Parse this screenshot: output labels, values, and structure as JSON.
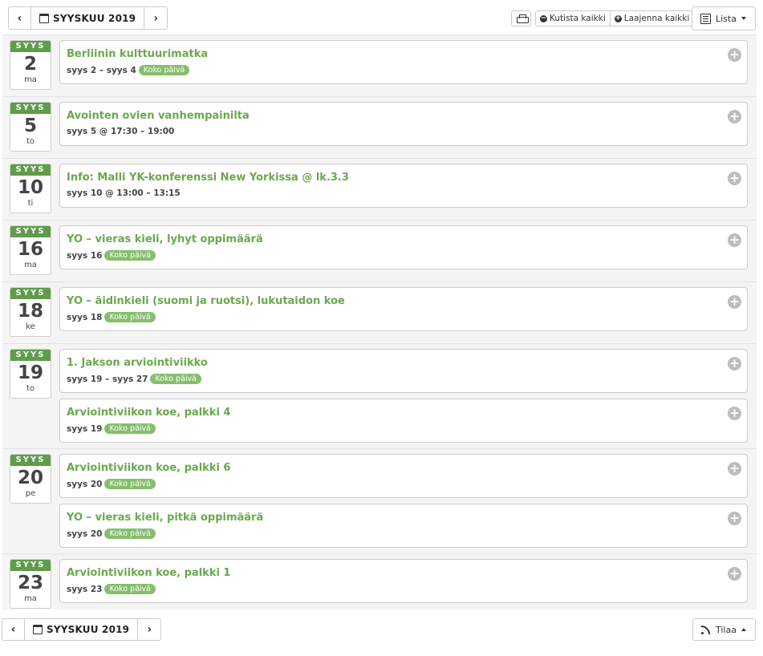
{
  "toolbar": {
    "month_label": "SYYSKUU 2019",
    "prev_label": "‹",
    "next_label": "›",
    "collapse_label": "Kutista kaikki",
    "expand_label": "Laajenna kaikki",
    "view_label": "Lista"
  },
  "footer": {
    "month_label": "SYYSKUU 2019",
    "subscribe_label": "Tilaa"
  },
  "colors": {
    "accent": "#5f9c4b",
    "title": "#6aa84f",
    "pill": "#86be6c"
  },
  "days": [
    {
      "mon": "SYYS",
      "num": "2",
      "dow": "ma",
      "events": [
        {
          "title": "Berliinin kulttuurimatka",
          "time": "syys 2 – syys 4",
          "allday": "Koko päivä"
        }
      ]
    },
    {
      "mon": "SYYS",
      "num": "5",
      "dow": "to",
      "events": [
        {
          "title": "Avointen ovien vanhempainilta",
          "time": "syys 5 @ 17:30 – 19:00",
          "allday": ""
        }
      ]
    },
    {
      "mon": "SYYS",
      "num": "10",
      "dow": "ti",
      "events": [
        {
          "title": "Info: Malli YK-konferenssi New Yorkissa @ lk.3.3",
          "time": "syys 10 @ 13:00 – 13:15",
          "allday": ""
        }
      ]
    },
    {
      "mon": "SYYS",
      "num": "16",
      "dow": "ma",
      "events": [
        {
          "title": "YO – vieras kieli, lyhyt oppimäärä",
          "time": "syys 16",
          "allday": "Koko päivä"
        }
      ]
    },
    {
      "mon": "SYYS",
      "num": "18",
      "dow": "ke",
      "events": [
        {
          "title": "YO – äidinkieli (suomi ja ruotsi), lukutaidon koe",
          "time": "syys 18",
          "allday": "Koko päivä"
        }
      ]
    },
    {
      "mon": "SYYS",
      "num": "19",
      "dow": "to",
      "events": [
        {
          "title": "1. Jakson arviointiviikko",
          "time": "syys 19 – syys 27",
          "allday": "Koko päivä"
        },
        {
          "title": "Arviointiviikon koe, palkki 4",
          "time": "syys 19",
          "allday": "Koko päivä"
        }
      ]
    },
    {
      "mon": "SYYS",
      "num": "20",
      "dow": "pe",
      "events": [
        {
          "title": "Arviointiviikon koe, palkki 6",
          "time": "syys 20",
          "allday": "Koko päivä"
        },
        {
          "title": "YO – vieras kieli, pitkä oppimäärä",
          "time": "syys 20",
          "allday": "Koko päivä"
        }
      ]
    },
    {
      "mon": "SYYS",
      "num": "23",
      "dow": "ma",
      "events": [
        {
          "title": "Arviointiviikon koe, palkki 1",
          "time": "syys 23",
          "allday": "Koko päivä"
        }
      ]
    }
  ]
}
